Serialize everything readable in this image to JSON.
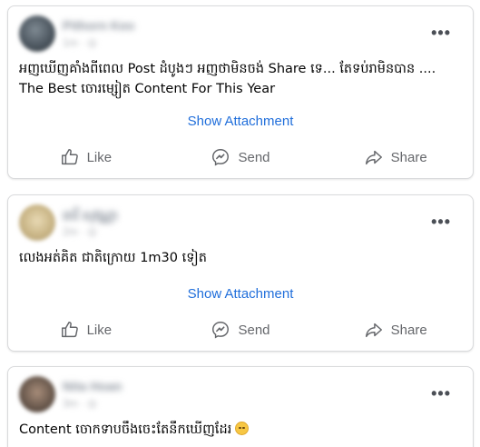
{
  "posts": [
    {
      "author": "Pithorn Keo",
      "meta": "1m · ◎",
      "body": "អញឃើញគាំងពីពេល Post ដំបូងៗ អញថាមិនចង់ Share ទេ... តែទប់រាមិនបាន .... The Best ចោរម្សៀត Content For This Year",
      "attachment_label": "Show Attachment",
      "actions": [
        "Like",
        "Send",
        "Share"
      ]
    },
    {
      "author": "ធារី សុវណ្ណា",
      "meta": "2m · ◎",
      "body": "លេងអត់គិត ជាតិក្រោយ 1m30 ទៀត",
      "attachment_label": "Show Attachment",
      "actions": [
        "Like",
        "Send",
        "Share"
      ]
    },
    {
      "author": "Nita Hoan",
      "meta": "3m · ◎",
      "body": "Content ចោកទាបចឹងចេះតែនឹកឃើញដែរ"
    }
  ],
  "icons": {
    "like": "thumbs-up-icon",
    "send": "messenger-icon",
    "share": "share-arrow-icon",
    "more": "more-dots-icon",
    "emoji": "relieved-face-emoji"
  },
  "colors": {
    "link": "#216fdb",
    "action_text": "#65676b",
    "card_border": "#d9dadc"
  }
}
